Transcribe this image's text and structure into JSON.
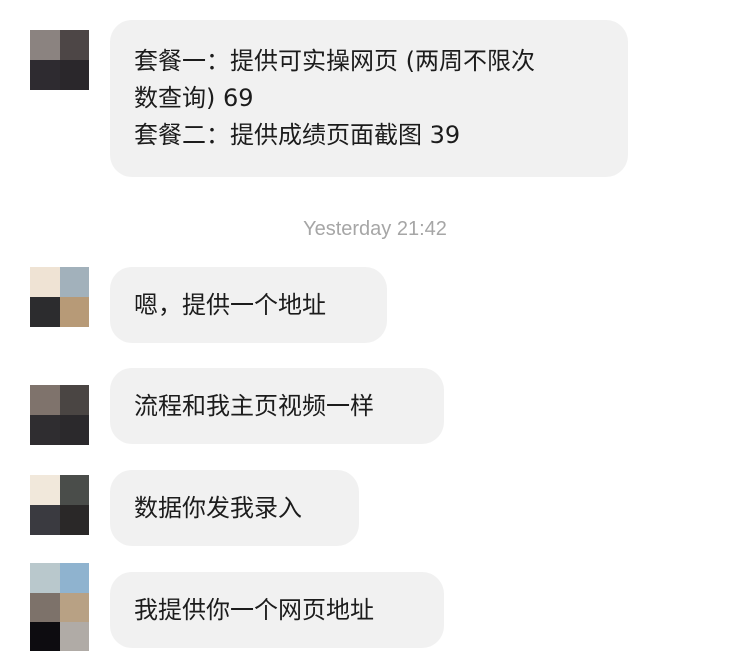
{
  "messages": [
    {
      "avatar_colors": [
        "#8b8380",
        "#4d4646",
        "#2e2b30",
        "#2a272b"
      ],
      "lines": [
        "套餐一：提供可实操网页 (两周不限次",
        "数查询) 69",
        "套餐二：提供成绩页面截图 39"
      ]
    },
    {
      "avatar_colors": [
        "#efe3d4",
        "#a2b1bb",
        "#2c2c2e",
        "#b79a77"
      ],
      "lines": [
        "嗯，提供一个地址"
      ]
    },
    {
      "avatar_colors": [
        "#7f736c",
        "#4a4543",
        "#2f2d30",
        "#2b292c"
      ],
      "lines": [
        "流程和我主页视频一样"
      ]
    },
    {
      "avatar_colors": [
        "#f1e8db",
        "#4a4d4a",
        "#3a3a40",
        "#2a2828"
      ],
      "lines": [
        "数据你发我录入"
      ]
    },
    {
      "avatar_colors": [
        "#b9c8cc",
        "#8fb3cf",
        "#7d726a",
        "#b8a184",
        "#0d0c10",
        "#b0aba6"
      ],
      "lines": [
        "我提供你一个网页地址"
      ]
    }
  ],
  "timestamp": "Yesterday 21:42"
}
